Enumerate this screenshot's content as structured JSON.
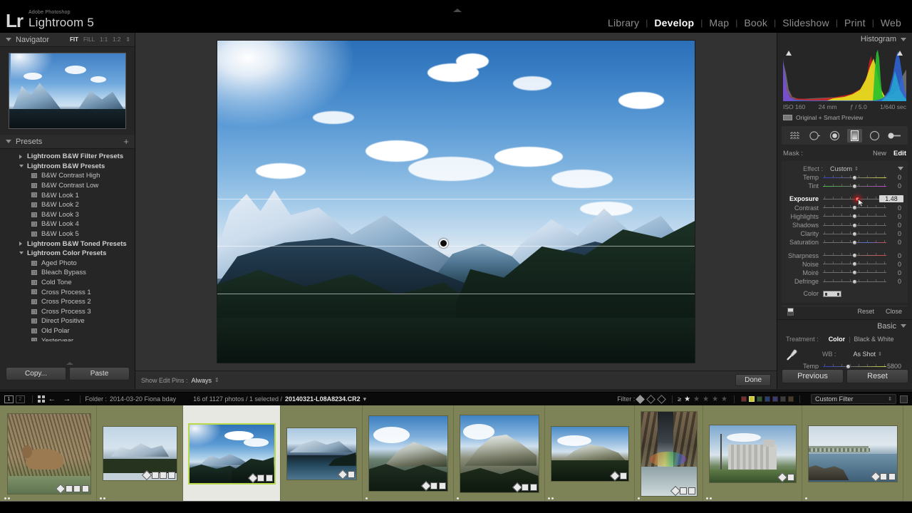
{
  "app": {
    "brand_superscript": "Adobe Photoshop",
    "brand_mark": "Lr",
    "brand_name": "Lightroom 5"
  },
  "modules": [
    {
      "label": "Library",
      "active": false
    },
    {
      "label": "Develop",
      "active": true
    },
    {
      "label": "Map",
      "active": false
    },
    {
      "label": "Book",
      "active": false
    },
    {
      "label": "Slideshow",
      "active": false
    },
    {
      "label": "Print",
      "active": false
    },
    {
      "label": "Web",
      "active": false
    }
  ],
  "navigator": {
    "title": "Navigator",
    "zoom_levels": [
      {
        "label": "FIT",
        "active": true
      },
      {
        "label": "FILL",
        "active": false
      },
      {
        "label": "1:1",
        "active": false
      },
      {
        "label": "1:2",
        "active": false
      }
    ]
  },
  "presets": {
    "title": "Presets",
    "add_label": "+",
    "items": [
      {
        "kind": "group",
        "label": "Lightroom B&W Filter Presets",
        "expanded": false
      },
      {
        "kind": "group",
        "label": "Lightroom B&W Presets",
        "expanded": true
      },
      {
        "kind": "item",
        "label": "B&W Contrast High"
      },
      {
        "kind": "item",
        "label": "B&W Contrast Low"
      },
      {
        "kind": "item",
        "label": "B&W Look 1"
      },
      {
        "kind": "item",
        "label": "B&W Look 2"
      },
      {
        "kind": "item",
        "label": "B&W Look 3"
      },
      {
        "kind": "item",
        "label": "B&W Look 4"
      },
      {
        "kind": "item",
        "label": "B&W Look 5"
      },
      {
        "kind": "group",
        "label": "Lightroom B&W Toned Presets",
        "expanded": false
      },
      {
        "kind": "group",
        "label": "Lightroom Color Presets",
        "expanded": true
      },
      {
        "kind": "item",
        "label": "Aged Photo"
      },
      {
        "kind": "item",
        "label": "Bleach Bypass"
      },
      {
        "kind": "item",
        "label": "Cold Tone"
      },
      {
        "kind": "item",
        "label": "Cross Process 1"
      },
      {
        "kind": "item",
        "label": "Cross Process 2"
      },
      {
        "kind": "item",
        "label": "Cross Process 3"
      },
      {
        "kind": "item",
        "label": "Direct Positive"
      },
      {
        "kind": "item",
        "label": "Old Polar"
      },
      {
        "kind": "item",
        "label": "Yesteryear"
      }
    ]
  },
  "left_buttons": {
    "copy_label": "Copy...",
    "paste_label": "Paste"
  },
  "toolbar": {
    "show_edit_pins_label": "Show Edit Pins :",
    "show_edit_pins_value": "Always",
    "done_label": "Done"
  },
  "histogram": {
    "title": "Histogram",
    "iso": "ISO 160",
    "focal": "24 mm",
    "aperture": "ƒ / 5.0",
    "shutter": "1/640 sec",
    "preview_status": "Original + Smart Preview"
  },
  "tools": [
    {
      "name": "crop-overlay-tool",
      "selected": false
    },
    {
      "name": "spot-removal-tool",
      "selected": false
    },
    {
      "name": "red-eye-correction-tool",
      "selected": false
    },
    {
      "name": "graduated-filter-tool",
      "selected": true
    },
    {
      "name": "radial-filter-tool",
      "selected": false
    },
    {
      "name": "adjustment-brush-tool",
      "selected": false
    }
  ],
  "mask": {
    "label": "Mask :",
    "new_label": "New",
    "edit_label": "Edit"
  },
  "effect_panel": {
    "effect_label": "Effect :",
    "effect_value": "Custom",
    "sliders": [
      {
        "name": "Temp",
        "value": "0",
        "pos": 50,
        "track": "temp",
        "highlight": false
      },
      {
        "name": "Tint",
        "value": "0",
        "pos": 50,
        "track": "tint",
        "highlight": false
      },
      {
        "name": "Exposure",
        "value": "1.48",
        "pos": 62,
        "track": "plain",
        "highlight": true
      },
      {
        "name": "Contrast",
        "value": "0",
        "pos": 50,
        "track": "plain",
        "highlight": false
      },
      {
        "name": "Highlights",
        "value": "0",
        "pos": 50,
        "track": "plain",
        "highlight": false
      },
      {
        "name": "Shadows",
        "value": "0",
        "pos": 50,
        "track": "plain",
        "highlight": false
      },
      {
        "name": "Clarity",
        "value": "0",
        "pos": 50,
        "track": "plain",
        "highlight": false
      },
      {
        "name": "Saturation",
        "value": "0",
        "pos": 50,
        "track": "sat",
        "highlight": false
      },
      {
        "name": "Sharpness",
        "value": "0",
        "pos": 50,
        "track": "sharp",
        "highlight": false
      },
      {
        "name": "Noise",
        "value": "0",
        "pos": 50,
        "track": "plain",
        "highlight": false
      },
      {
        "name": "Moiré",
        "value": "0",
        "pos": 50,
        "track": "plain",
        "highlight": false
      },
      {
        "name": "Defringe",
        "value": "0",
        "pos": 50,
        "track": "plain",
        "highlight": false
      }
    ],
    "color_label": "Color",
    "reset_label": "Reset",
    "close_label": "Close"
  },
  "basic": {
    "title": "Basic",
    "treatment_label": "Treatment :",
    "treatment_color": "Color",
    "treatment_bw": "Black & White",
    "wb_label": "WB :",
    "wb_value": "As Shot",
    "temp_label": "Temp",
    "temp_value": "5800"
  },
  "right_buttons": {
    "previous_label": "Previous",
    "reset_label": "Reset"
  },
  "filmstrip_bar": {
    "screen1": "1",
    "screen2": "2",
    "folder_label": "Folder :",
    "folder_name": "2014-03-20 Fiona bday",
    "count_text": "16 of 1127 photos / 1 selected /",
    "filename": "20140321-L08A8234.CR2",
    "filter_label": "Filter :",
    "rating_op": "≥",
    "custom_filter": "Custom Filter"
  },
  "filmstrip": {
    "thumbs": [
      {
        "name": "deer-in-brush",
        "w": 116,
        "h": 112,
        "scene": "deer",
        "selected": false,
        "badges": 4,
        "dots": 2
      },
      {
        "name": "snow-mountain-lake",
        "w": 103,
        "h": 75,
        "scene": "mtn-lake",
        "selected": false,
        "badges": 4,
        "dots": 2
      },
      {
        "name": "blue-sky-mountain-valley",
        "w": 119,
        "h": 82,
        "scene": "hero",
        "selected": true,
        "badges": 3,
        "dots": 2
      },
      {
        "name": "fjord-lake",
        "w": 97,
        "h": 72,
        "scene": "fjord",
        "selected": false,
        "badges": 2,
        "dots": 0
      },
      {
        "name": "snowy-ridge-a",
        "w": 110,
        "h": 105,
        "scene": "ridge",
        "selected": false,
        "badges": 3,
        "dots": 1
      },
      {
        "name": "snowy-ridge-b",
        "w": 110,
        "h": 108,
        "scene": "ridge2",
        "selected": false,
        "badges": 3,
        "dots": 1
      },
      {
        "name": "snowy-ridge-c",
        "w": 108,
        "h": 76,
        "scene": "ridge3",
        "selected": false,
        "badges": 2,
        "dots": 2
      },
      {
        "name": "rainbow-waterfall",
        "w": 78,
        "h": 118,
        "scene": "falls",
        "selected": false,
        "badges": 3,
        "dots": 1
      },
      {
        "name": "grain-silo",
        "w": 121,
        "h": 80,
        "scene": "silo",
        "selected": false,
        "badges": 2,
        "dots": 2
      },
      {
        "name": "coastal-bridge",
        "w": 124,
        "h": 78,
        "scene": "coast",
        "selected": false,
        "badges": 3,
        "dots": 1
      }
    ]
  },
  "colors": {
    "filmstrip_bg": "#7d8257",
    "selected_cell": "#e8e8e2",
    "selection_outline": "#b9d94a",
    "panel_bg": "#262626",
    "canvas_bg": "#323232",
    "accent_red": "#c81b1b"
  }
}
